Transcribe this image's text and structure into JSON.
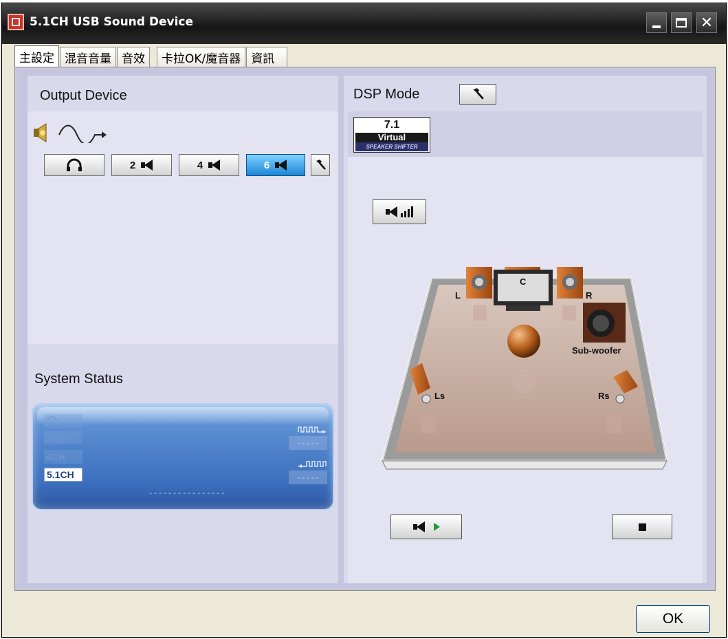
{
  "window": {
    "title": "5.1CH USB Sound Device"
  },
  "tabs": [
    {
      "label": "主設定"
    },
    {
      "label": "混音音量"
    },
    {
      "label": "音效"
    },
    {
      "label": "卡拉OK/魔音器"
    },
    {
      "label": "資訊"
    }
  ],
  "output_device": {
    "title": "Output Device",
    "buttons": [
      {
        "label": "",
        "icon": "headphones-icon"
      },
      {
        "label": "2",
        "icon": "speaker-icon"
      },
      {
        "label": "4",
        "icon": "speaker-icon"
      },
      {
        "label": "6",
        "icon": "speaker-icon",
        "selected": true
      }
    ]
  },
  "system_status": {
    "title": "System Status",
    "channel_tags": [
      {
        "label": "",
        "icon": "headphones-icon",
        "active": false
      },
      {
        "label": "2CH",
        "active": false
      },
      {
        "label": "4CH",
        "active": false
      },
      {
        "label": "5.1CH",
        "active": true
      }
    ],
    "output_value": "-----",
    "input_value": "-----",
    "meter_text": "----------------"
  },
  "dsp": {
    "title": "DSP Mode",
    "badge": {
      "number": "7.1",
      "label": "Virtual",
      "sub": "SPEAKER SHIFTER"
    },
    "speakers": {
      "center": "C",
      "left": "L",
      "right": "R",
      "sub": "Sub-woofer",
      "left_surround": "Ls",
      "right_surround": "Rs"
    }
  },
  "dialog": {
    "ok_label": "OK"
  },
  "colors": {
    "titlebar": "#1f1f1f",
    "panel": "#c5c5df",
    "selected_button": "#1c86d6",
    "status_panel": "#3c6fbe",
    "speaker_wood": "#c8641e"
  }
}
